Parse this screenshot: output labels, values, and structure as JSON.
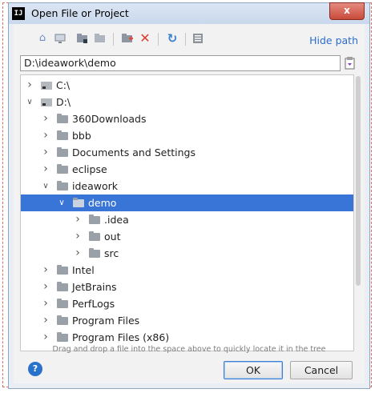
{
  "window": {
    "title": "Open File or Project",
    "close_symbol": "x",
    "app_icon_text": "IJ"
  },
  "toolbar": {
    "hide_path_label": "Hide path"
  },
  "path": {
    "value": "D:\\ideawork\\demo"
  },
  "tree": {
    "rows": [
      {
        "label": "C:\\",
        "level": 0,
        "expanded": false,
        "type": "drive",
        "selected": false
      },
      {
        "label": "D:\\",
        "level": 0,
        "expanded": true,
        "type": "drive",
        "selected": false
      },
      {
        "label": "360Downloads",
        "level": 1,
        "expanded": false,
        "type": "folder",
        "selected": false
      },
      {
        "label": "bbb",
        "level": 1,
        "expanded": false,
        "type": "folder",
        "selected": false
      },
      {
        "label": "Documents and Settings",
        "level": 1,
        "expanded": false,
        "type": "folder",
        "selected": false
      },
      {
        "label": "eclipse",
        "level": 1,
        "expanded": false,
        "type": "folder",
        "selected": false
      },
      {
        "label": "ideawork",
        "level": 1,
        "expanded": true,
        "type": "folder",
        "selected": false
      },
      {
        "label": "demo",
        "level": 2,
        "expanded": true,
        "type": "folder",
        "selected": true
      },
      {
        "label": ".idea",
        "level": 3,
        "expanded": false,
        "type": "folder",
        "selected": false
      },
      {
        "label": "out",
        "level": 3,
        "expanded": false,
        "type": "folder",
        "selected": false
      },
      {
        "label": "src",
        "level": 3,
        "expanded": false,
        "type": "folder",
        "selected": false
      },
      {
        "label": "Intel",
        "level": 1,
        "expanded": false,
        "type": "folder",
        "selected": false
      },
      {
        "label": "JetBrains",
        "level": 1,
        "expanded": false,
        "type": "folder",
        "selected": false
      },
      {
        "label": "PerfLogs",
        "level": 1,
        "expanded": false,
        "type": "folder",
        "selected": false
      },
      {
        "label": "Program Files",
        "level": 1,
        "expanded": false,
        "type": "folder",
        "selected": false
      },
      {
        "label": "Program Files (x86)",
        "level": 1,
        "expanded": false,
        "type": "folder",
        "selected": false
      }
    ]
  },
  "hint": "Drag and drop a file into the space above to quickly locate it in the tree",
  "footer": {
    "ok_label": "OK",
    "cancel_label": "Cancel",
    "help_symbol": "?"
  },
  "colors": {
    "selection": "#3875d7",
    "link": "#2c6cc9",
    "accent": "#2a72c9"
  }
}
